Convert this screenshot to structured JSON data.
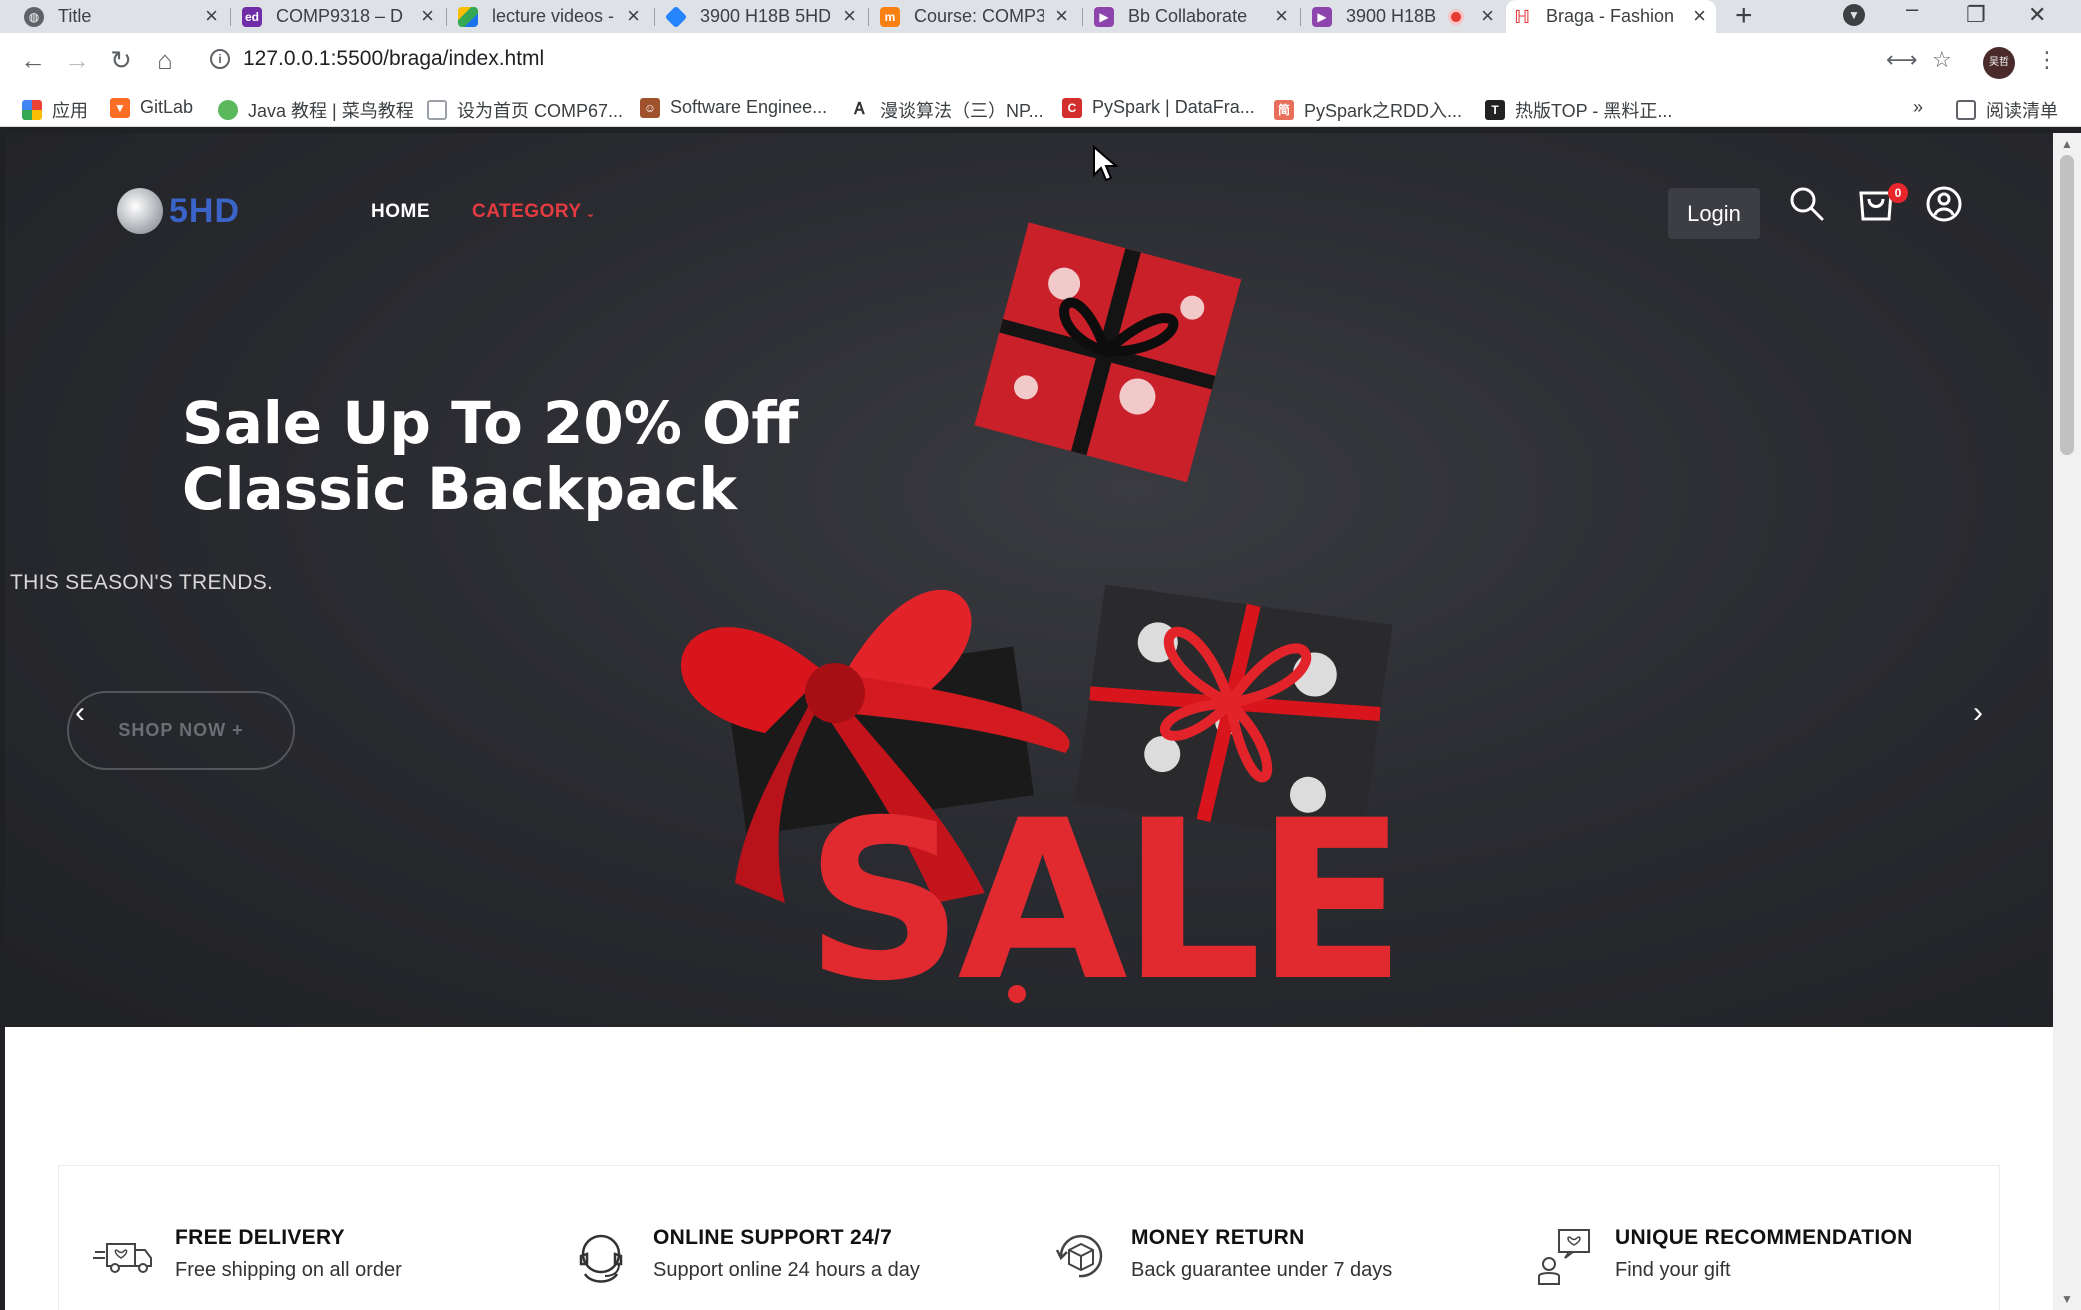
{
  "browser": {
    "tabs": [
      {
        "title": "Title",
        "favicon": "globe-icon",
        "color": "#5f6368"
      },
      {
        "title": "COMP9318 – D",
        "favicon": "ed-icon",
        "color": "#6f2da8"
      },
      {
        "title": "lecture videos -",
        "favicon": "drive-icon",
        "color": "#1a73e8"
      },
      {
        "title": "3900 H18B 5HD",
        "favicon": "jira-icon",
        "color": "#2684ff"
      },
      {
        "title": "Course: COMP3",
        "favicon": "moodle-icon",
        "color": "#f98012"
      },
      {
        "title": "Bb Collaborate",
        "favicon": "collab-icon",
        "color": "#8e44ad"
      },
      {
        "title": "3900 H18B",
        "favicon": "collab-icon",
        "color": "#8e44ad"
      },
      {
        "title": "Braga - Fashion",
        "favicon": "braga-icon",
        "color": "#e33b3f"
      }
    ],
    "url": "127.0.0.1:5500/braga/index.html",
    "bookmarks": [
      {
        "label": "应用",
        "icon": "apps-grid-icon",
        "color": "#ea4335"
      },
      {
        "label": "GitLab",
        "icon": "gitlab-icon",
        "color": "#fc6d26"
      },
      {
        "label": "Java 教程 | 菜鸟教程",
        "icon": "runoob-icon",
        "color": "#5cb85c"
      },
      {
        "label": "设为首页 COMP67...",
        "icon": "page-icon",
        "color": "#9aa0a6"
      },
      {
        "label": "Software Enginee...",
        "icon": "person-icon",
        "color": "#a0522d"
      },
      {
        "label": "漫谈算法（三）NP...",
        "icon": "algo-icon",
        "color": "#555555"
      },
      {
        "label": "PySpark | DataFra...",
        "icon": "c-icon",
        "color": "#d32f2f"
      },
      {
        "label": "PySpark之RDD入...",
        "icon": "jianshu-icon",
        "color": "#ea6f5a"
      },
      {
        "label": "热版TOP - 黑料正...",
        "icon": "t-icon",
        "color": "#222222"
      }
    ],
    "bookmarks_more": "»",
    "reading_list": "阅读清单",
    "profile_initials": "吴哲"
  },
  "page": {
    "brand": "5HD",
    "nav": {
      "home": "HOME",
      "category": "CATEGORY"
    },
    "login_label": "Login",
    "cart_count": "0",
    "hero": {
      "title_line1": "Sale Up To 20% Off",
      "title_line2": "Classic Backpack",
      "subtitle": "THIS SEASON'S TRENDS.",
      "cta": "SHOP NOW +",
      "sale_word": "SALE"
    },
    "features": [
      {
        "title": "FREE DELIVERY",
        "desc": "Free shipping on all order",
        "icon": "delivery-truck-icon"
      },
      {
        "title": "ONLINE SUPPORT 24/7",
        "desc": "Support online 24 hours a day",
        "icon": "support-headset-icon"
      },
      {
        "title": "MONEY RETURN",
        "desc": "Back guarantee under 7 days",
        "icon": "money-return-icon"
      },
      {
        "title": "UNIQUE RECOMMENDATION",
        "desc": "Find your gift",
        "icon": "recommendation-icon"
      }
    ]
  },
  "colors": {
    "accent": "#e33b3f",
    "hero_bg": "#2b2c31",
    "brand_blue": "#3a64c8"
  }
}
